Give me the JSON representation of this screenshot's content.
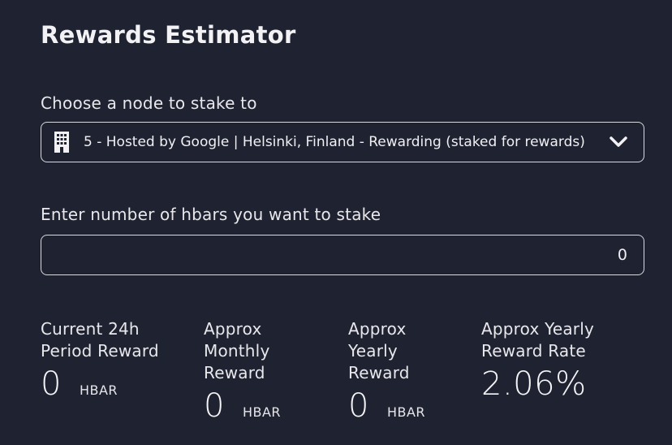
{
  "estimator": {
    "title": "Rewards Estimator",
    "node_label": "Choose a node to stake to",
    "node_selected": "5 - Hosted by Google | Helsinki, Finland - Rewarding (staked for rewards)",
    "amount_label": "Enter number of hbars you want to stake",
    "amount_value": "0"
  },
  "stats": [
    {
      "label": "Current 24h\nPeriod Reward",
      "value": "0",
      "unit": "HBAR"
    },
    {
      "label": "Approx\nMonthly\nReward",
      "value": "0",
      "unit": "HBAR"
    },
    {
      "label": "Approx\nYearly\nReward",
      "value": "0",
      "unit": "HBAR"
    },
    {
      "label": "Approx Yearly\nReward Rate",
      "value": "2.06%"
    }
  ],
  "icons": {
    "node": "building-icon",
    "dropdown": "chevron-down-icon"
  },
  "colors": {
    "background": "#1f2230",
    "text": "#f2f2f4",
    "border": "#d9dae0"
  }
}
